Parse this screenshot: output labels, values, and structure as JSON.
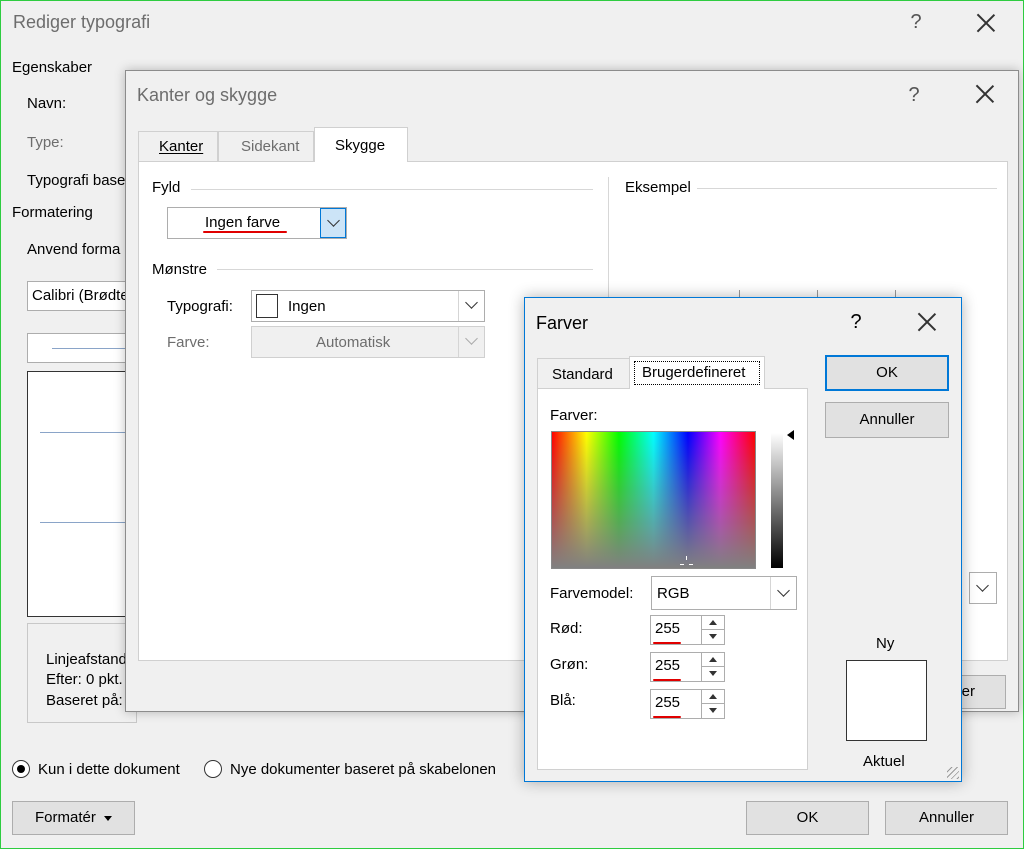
{
  "outer": {
    "title": "Rediger typografi",
    "help": "?",
    "section_properties": "Egenskaber",
    "name_label": "Navn:",
    "type_label": "Type:",
    "based_on_label": "Typografi base",
    "section_formatting": "Formatering",
    "apply_label": "Anvend forma",
    "font_value": "Calibri (Brødte",
    "desc_line1": "Linjeafstand",
    "desc_line2": "Efter:  0 pkt.",
    "desc_line3": "Baseret på: T",
    "radio_only_doc": "Kun i dette dokument",
    "radio_new_docs": "Nye dokumenter baseret på skabelonen",
    "format_button": "Formatér",
    "ok": "OK",
    "cancel": "Annuller"
  },
  "borders": {
    "title": "Kanter og skygge",
    "help": "?",
    "tabs": [
      "Kanter",
      "Sidekant",
      "Skygge"
    ],
    "active_tab": "Skygge",
    "fill_label": "Fyld",
    "fill_value": "Ingen farve",
    "pattern_label": "Mønstre",
    "style_label": "Typografi:",
    "style_value": "Ingen",
    "color_label": "Farve:",
    "color_value": "Automatisk",
    "preview_label": "Eksempel",
    "hidden_button_partial": "er"
  },
  "colors": {
    "title": "Farver",
    "help": "?",
    "tabs": [
      "Standard",
      "Brugerdefineret"
    ],
    "active_tab": "Brugerdefineret",
    "colors_label": "Farver:",
    "model_label": "Farvemodel:",
    "model_value": "RGB",
    "red_label": "Rød:",
    "green_label": "Grøn:",
    "blue_label": "Blå:",
    "red_value": "255",
    "green_value": "255",
    "blue_value": "255",
    "ok": "OK",
    "cancel": "Annuller",
    "new_label": "Ny",
    "current_label": "Aktuel",
    "accent": "#0078d7",
    "annotation_color": "#e00000"
  }
}
